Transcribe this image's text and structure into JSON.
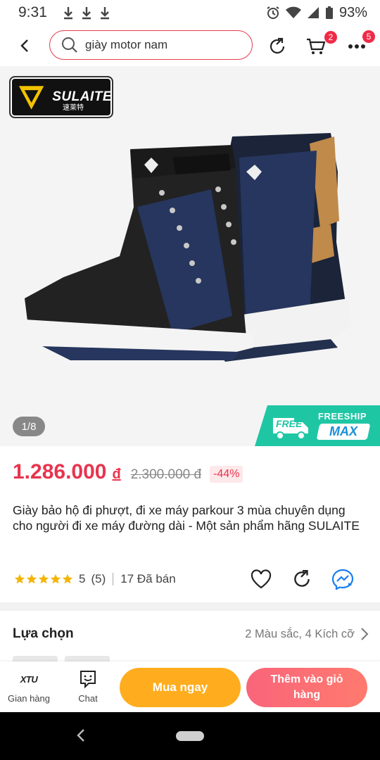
{
  "status_bar": {
    "time": "9:31",
    "battery": "93%"
  },
  "topnav": {
    "search_value": "giày motor nam",
    "cart_badge": "2",
    "more_badge": "5"
  },
  "product": {
    "brand": {
      "name": "SULAITE",
      "cn": "速莱特"
    },
    "image_counter": "1/8",
    "freeship": {
      "free": "FREE",
      "label": "FREESHIP",
      "max": "MAX"
    },
    "price": "1.286.000",
    "currency": "đ",
    "old_price": "2.300.000 đ",
    "discount": "-44%",
    "title": "Giày bảo hộ đi phượt, đi xe máy parkour 3 mùa chuyên dụng cho người đi xe máy đường dài - Một sản phẩm hãng SULAITE",
    "rating": "5",
    "review_count": "(5)",
    "sold": "17 Đã bán"
  },
  "options": {
    "title": "Lựa chọn",
    "summary": "2 Màu sắc, 4 Kích cỡ"
  },
  "bottom_bar": {
    "store_logo": "XTU",
    "store_label": "Gian hàng",
    "chat_label": "Chat",
    "buy_now": "Mua ngay",
    "add_to_cart": "Thêm vào giỏ hàng"
  },
  "colors": {
    "accent": "#e8344e",
    "buy_now": "#ffad1f",
    "freeship": "#1fc6a4",
    "star": "#f5b400"
  }
}
